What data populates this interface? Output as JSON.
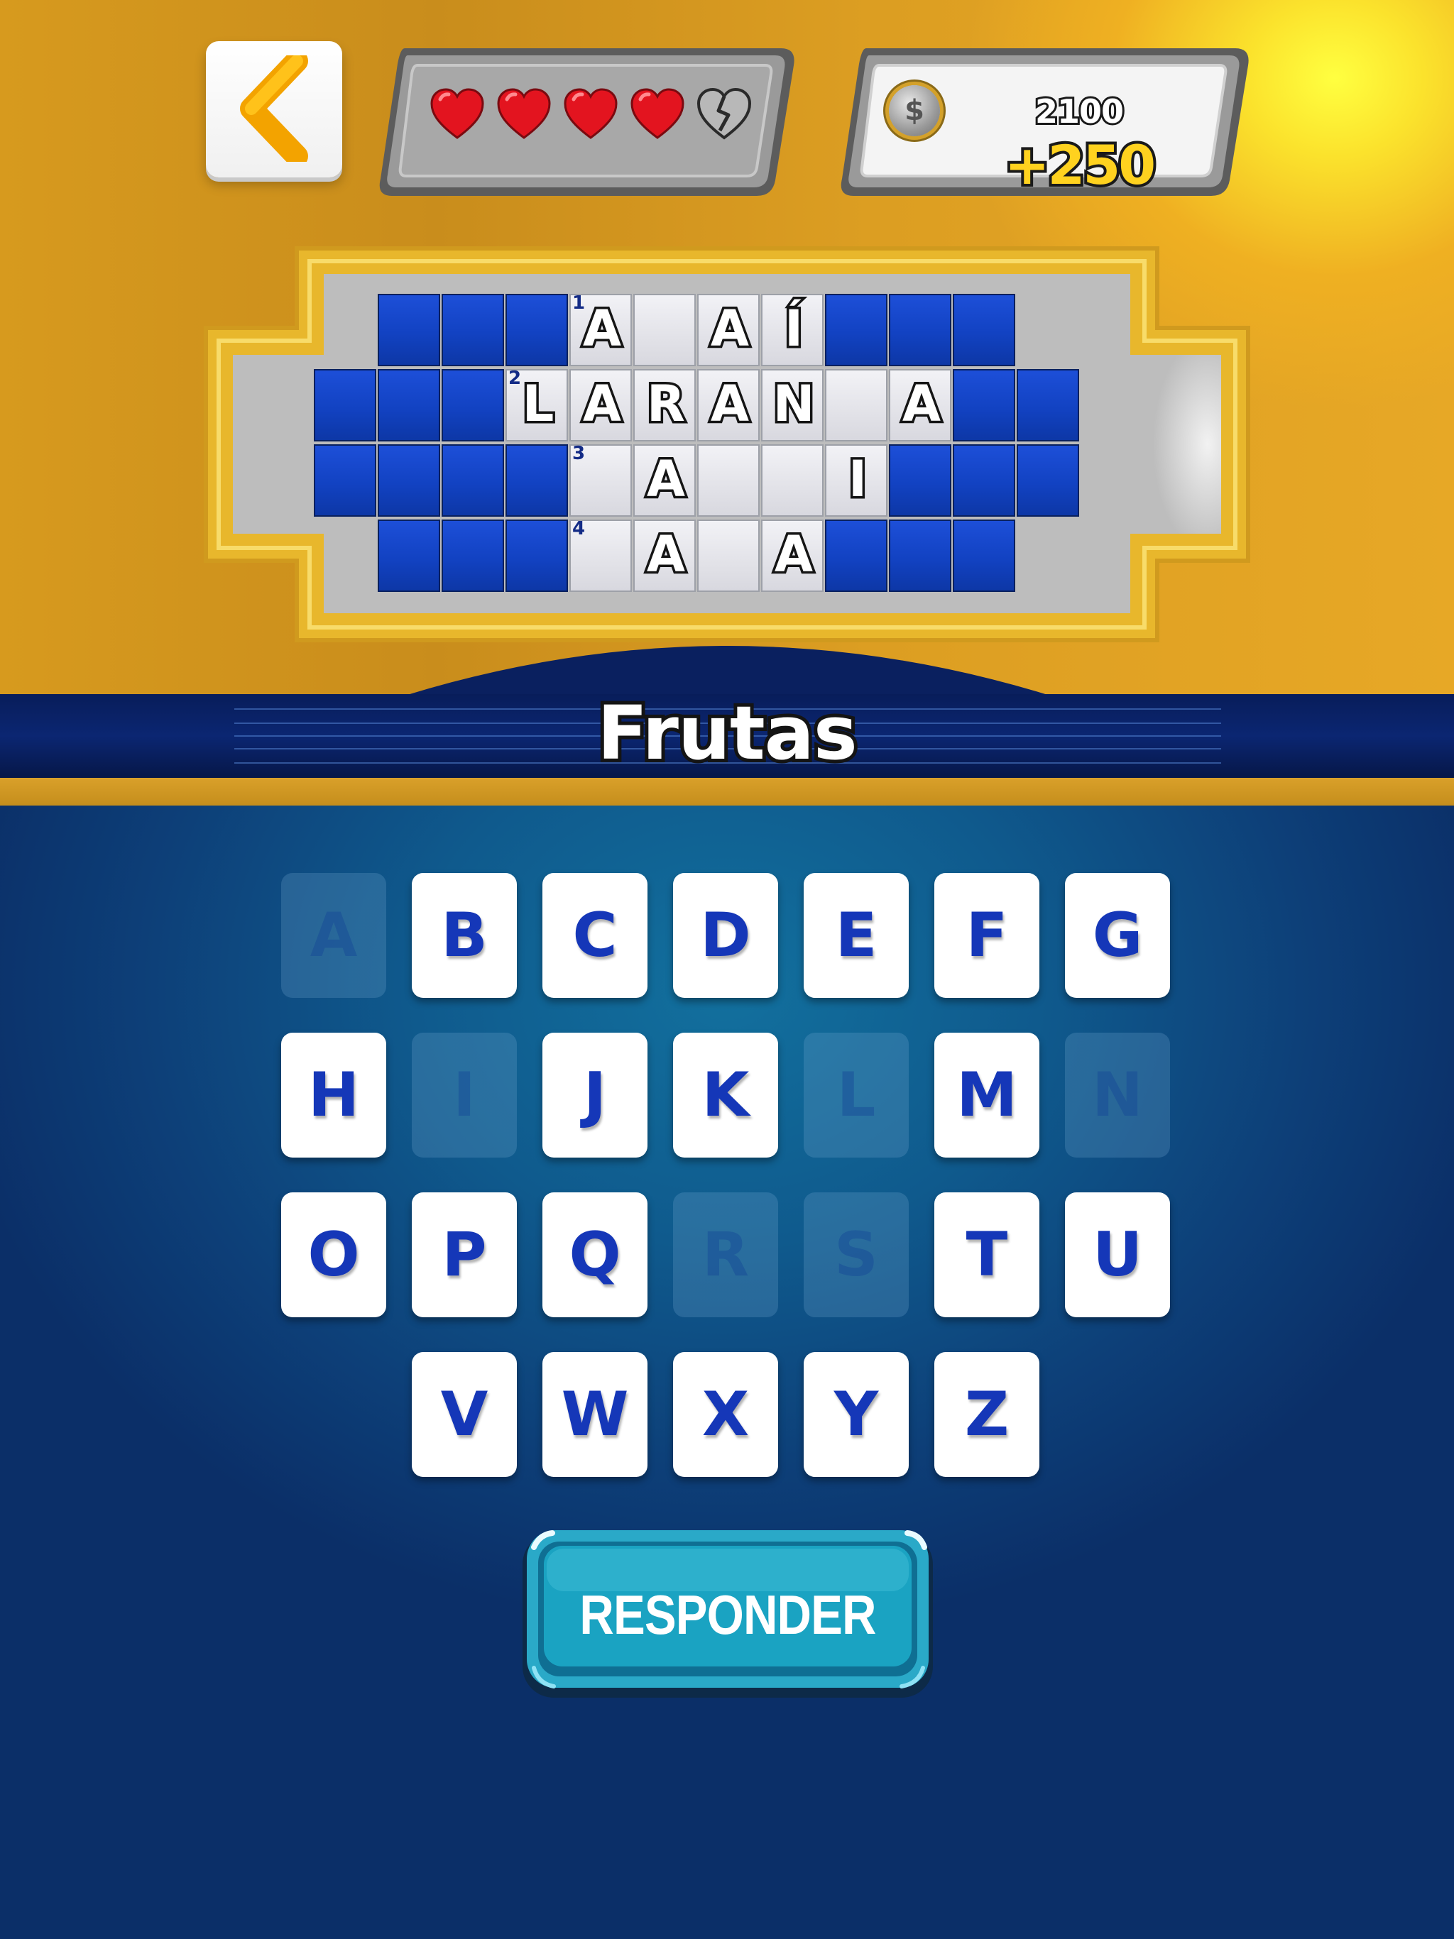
{
  "header": {
    "back_icon": "chevron-left-icon",
    "lives": [
      "heart-full",
      "heart-full",
      "heart-full",
      "heart-full",
      "heart-broken"
    ],
    "coins": {
      "icon": "dollar-coin-icon",
      "symbol": "$",
      "value": "2100",
      "bonus": "+250"
    }
  },
  "board": {
    "rows": [
      {
        "number": "1",
        "cells": [
          "A",
          "",
          "A",
          "Í"
        ]
      },
      {
        "number": "2",
        "cells": [
          "L",
          "A",
          "R",
          "A",
          "N",
          "",
          "A"
        ]
      },
      {
        "number": "3",
        "cells": [
          "",
          "A",
          "",
          "",
          "I"
        ]
      },
      {
        "number": "4",
        "cells": [
          "",
          "A",
          "",
          "A"
        ]
      }
    ]
  },
  "category": "Frutas",
  "keyboard": {
    "letters": [
      "A",
      "B",
      "C",
      "D",
      "E",
      "F",
      "G",
      "H",
      "I",
      "J",
      "K",
      "L",
      "M",
      "N",
      "O",
      "P",
      "Q",
      "R",
      "S",
      "T",
      "U",
      "V",
      "W",
      "X",
      "Y",
      "Z"
    ],
    "used": [
      "A",
      "I",
      "L",
      "N",
      "R",
      "S"
    ]
  },
  "answer_button": "RESPONDER",
  "colors": {
    "board_blue": "#1242c2",
    "key_text": "#1537b8",
    "bonus_yellow": "#ffd21f",
    "answer_teal": "#1aa3c2"
  }
}
